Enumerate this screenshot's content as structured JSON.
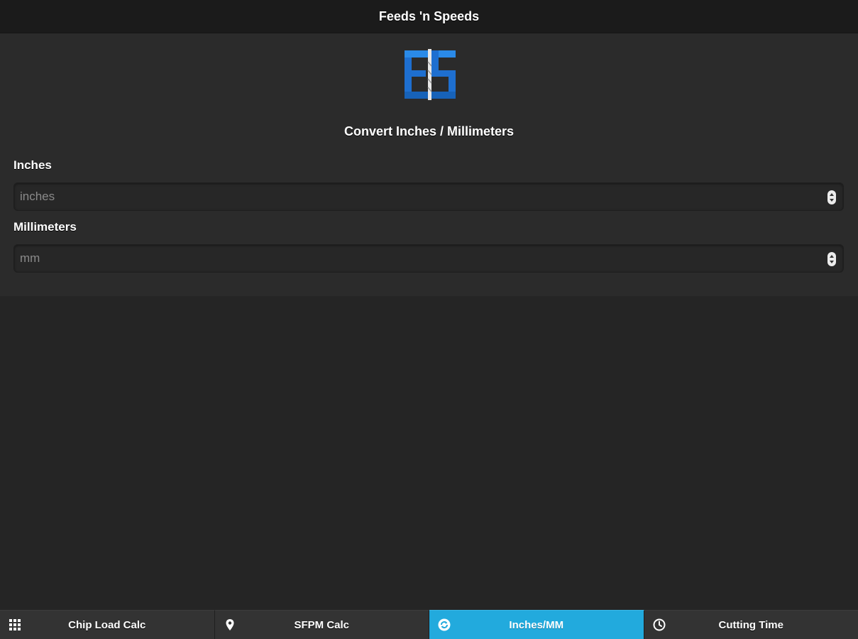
{
  "header": {
    "title": "Feeds 'n Speeds"
  },
  "main": {
    "section_title": "Convert Inches / Millimeters",
    "fields": [
      {
        "label": "Inches",
        "placeholder": "inches",
        "value": ""
      },
      {
        "label": "Millimeters",
        "placeholder": "mm",
        "value": ""
      }
    ]
  },
  "tabs": [
    {
      "label": "Chip Load Calc",
      "icon": "grid-icon",
      "active": false
    },
    {
      "label": "SFPM Calc",
      "icon": "location-pin-icon",
      "active": false
    },
    {
      "label": "Inches/MM",
      "icon": "refresh-icon",
      "active": true
    },
    {
      "label": "Cutting Time",
      "icon": "clock-icon",
      "active": false
    }
  ],
  "colors": {
    "accent": "#22aadd",
    "logo_blue": "#1e6fd0",
    "background": "#252525"
  }
}
